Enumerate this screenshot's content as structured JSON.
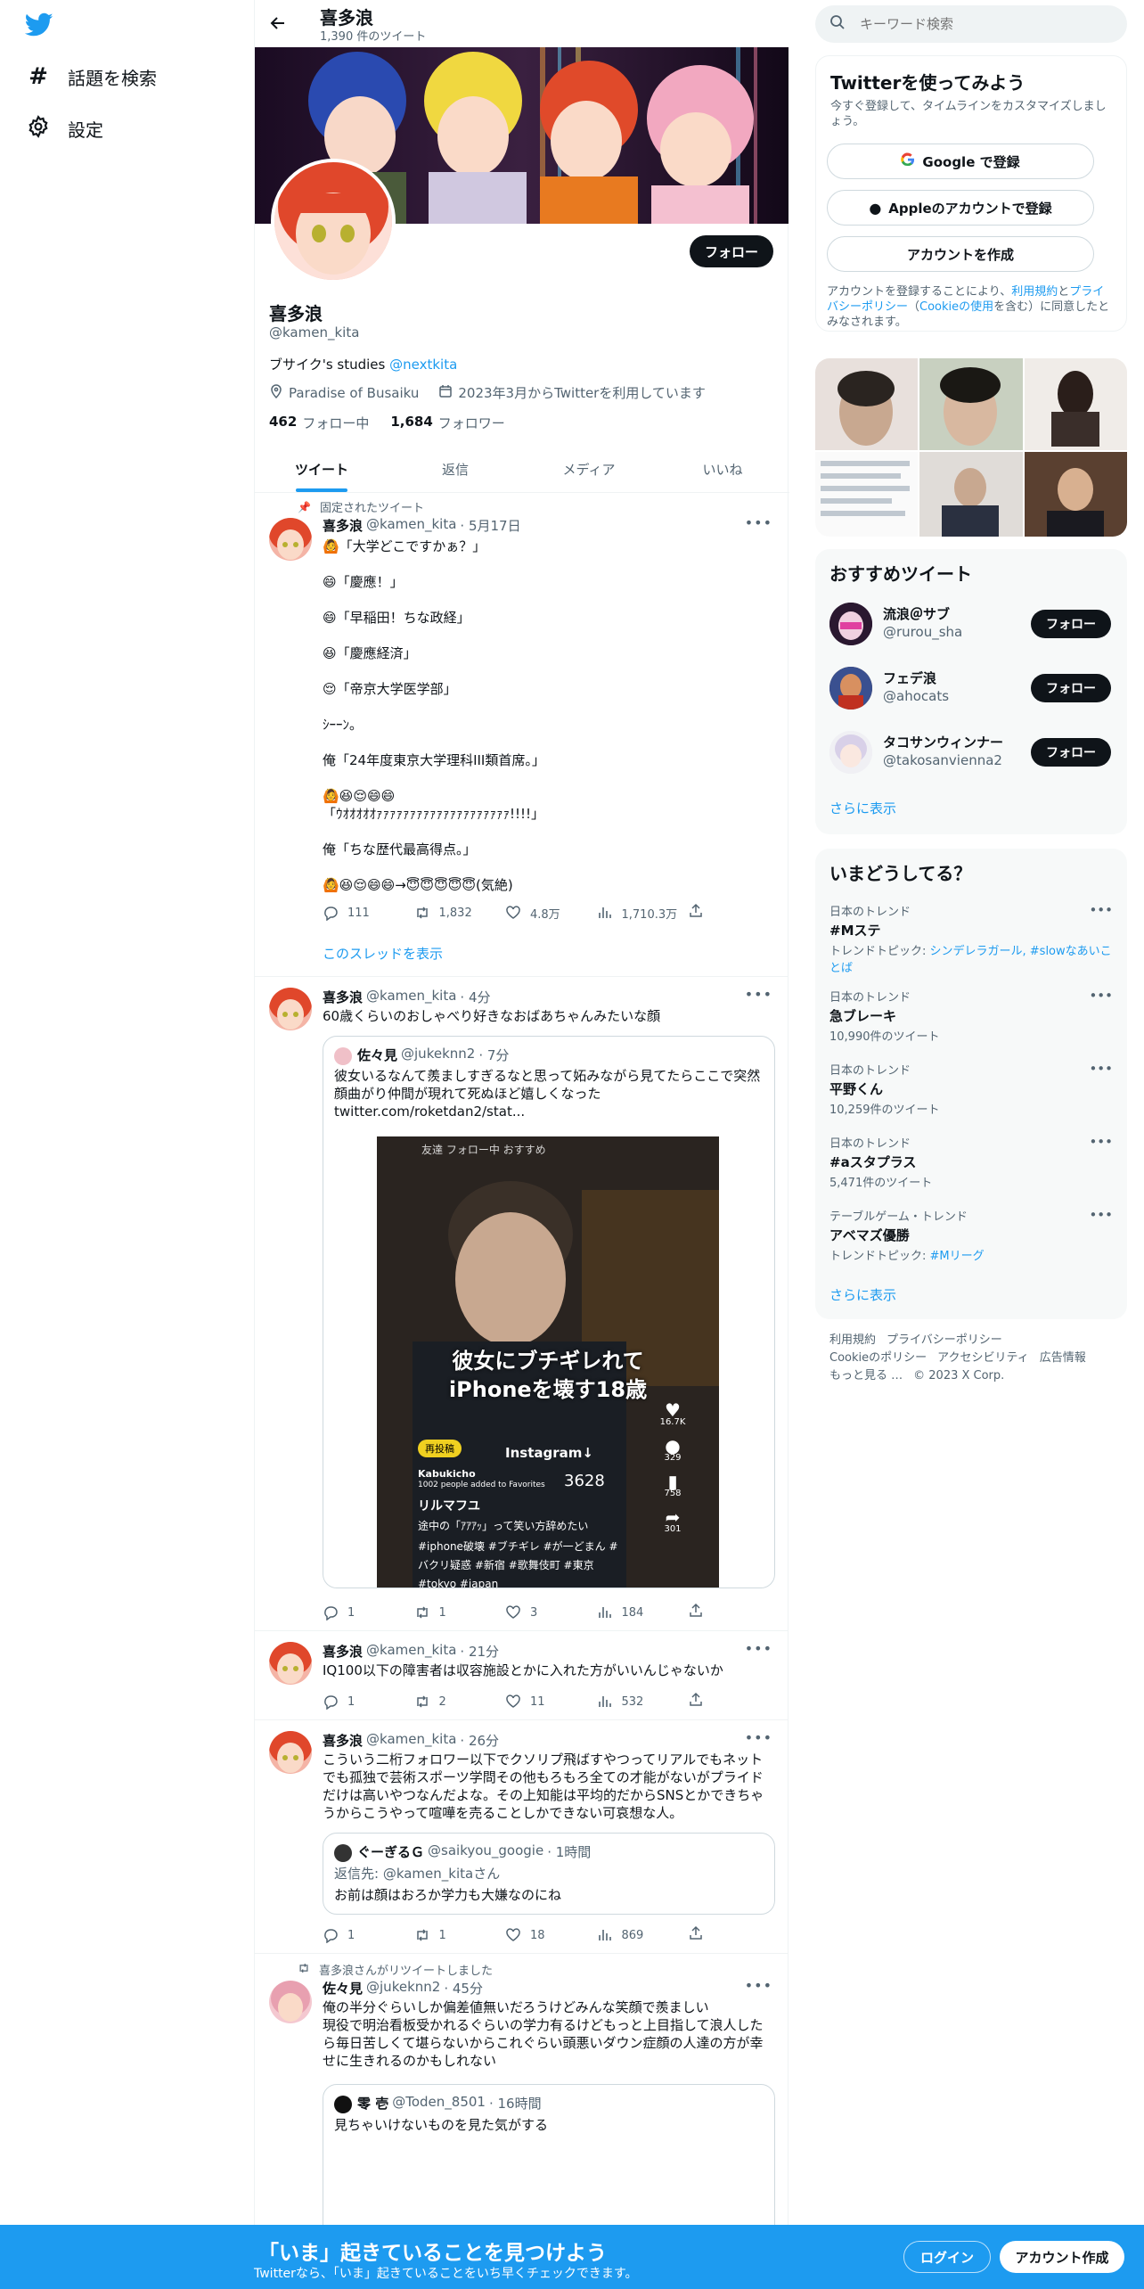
{
  "leftnav": {
    "items": [
      {
        "label": "話題を検索",
        "icon": "hashtag-icon"
      },
      {
        "label": "設定",
        "icon": "gear-icon"
      }
    ]
  },
  "header": {
    "name": "喜多浪",
    "tweet_count": "1,390 件のツイート"
  },
  "profile": {
    "name": "喜多浪",
    "handle": "@kamen_kita",
    "follow_label": "フォロー",
    "bio_text": "ブサイク's studies ",
    "bio_link": "@nextkita",
    "location": "Paradise of Busaiku",
    "joined": "2023年3月からTwitterを利用しています",
    "following_count": "462",
    "following_label": "フォロー中",
    "followers_count": "1,684",
    "followers_label": "フォロワー"
  },
  "tabs": [
    "ツイート",
    "返信",
    "メディア",
    "いいね"
  ],
  "tweets": [
    {
      "pinned_label": "固定されたツイート",
      "name": "喜多浪",
      "handle": "@kamen_kita",
      "time": "· 5月17日",
      "text": "🙆「大学どこですかぁ？」\n\n😄「慶應！」\n\n😄「早稲田！ちな政経」\n\n😆「慶應経済」\n\n😌「帝京大学医学部」\n\nｼｰｰﾝ。\n\n俺「24年度東京大学理科III類首席。」\n\n🙆😆😌😄😄\n「ｳｵｵｵｵｵｧｧｧｧｧｧｧｧｧｧｧｧｧｧｧｧｧｧｧｧ!!!!」\n\n俺「ちな歴代最高得点。」\n\n🙆😆😌😄😄→😇😇😇😇😇(気絶)",
      "reply": "111",
      "retweet": "1,832",
      "like": "4.8万",
      "views": "1,710.3万",
      "show_thread": "このスレッドを表示"
    },
    {
      "name": "喜多浪",
      "handle": "@kamen_kita",
      "time": "· 4分",
      "text": "60歳くらいのおしゃべり好きなおばあちゃんみたいな顔",
      "quote": {
        "name": "佐々見",
        "handle": "@jukeknn2",
        "time": "· 7分",
        "text": "彼女いるなんて羨ましすぎるなと思って妬みながら見てたらここで突然顔曲がり仲間が現れて死ぬほど嬉しくなった\ntwitter.com/roketdan2/stat...",
        "video_caption_1": "彼女にブチギレれて",
        "video_caption_2": "iPhoneを壊す18歳",
        "video_top": "友達  フォロー中  おすすめ",
        "video_user": "リルマフユ",
        "video_desc": "途中の「ｱｱｱｯ」って笑い方辞めたい",
        "video_tags": "#iphone破壊 #ブチギレ #が一どまん #\nバクリ疑惑 #新宿 #歌舞伎町 #東京\n#tokyo #japan",
        "video_place": "Kabukicho",
        "video_place_sub": "1002 people added to Favorites",
        "video_instagram": "Instagram↓",
        "video_num": "3628",
        "video_repost": "再投稿",
        "video_likes": "16.7K",
        "video_comments": "329",
        "video_saves": "758",
        "video_shares": "301"
      },
      "reply": "1",
      "retweet": "1",
      "like": "3",
      "views": "184"
    },
    {
      "name": "喜多浪",
      "handle": "@kamen_kita",
      "time": "· 21分",
      "text": "IQ100以下の障害者は収容施設とかに入れた方がいいんじゃないか",
      "reply": "1",
      "retweet": "2",
      "like": "11",
      "views": "532"
    },
    {
      "name": "喜多浪",
      "handle": "@kamen_kita",
      "time": "· 26分",
      "text": "こういう二桁フォロワー以下でクソリプ飛ばすやつってリアルでもネットでも孤独で芸術スポーツ学問その他もろもろ全ての才能がないがプライドだけは高いやつなんだよな。その上知能は平均的だからSNSとかできちゃうからこうやって喧嘩を売ることしかできない可哀想な人。",
      "quote": {
        "name": "ぐーぎるＧ",
        "handle": "@saikyou_googie",
        "time": "· 1時間",
        "reply_to": "返信先: @kamen_kitaさん",
        "text": "お前は顔はおろか学力も大嫌なのにね"
      },
      "reply": "1",
      "retweet": "1",
      "like": "18",
      "views": "869"
    },
    {
      "retweeted_by": "喜多浪さんがリツイートしました",
      "name": "佐々見",
      "handle": "@jukeknn2",
      "time": "· 45分",
      "text": "俺の半分ぐらいしか偏差値無いだろうけどみんな笑顔で羨ましい\n現役で明治看板受かれるぐらいの学力有るけどもっと上目指して浪人したら毎日苦しくて堪らないからこれぐらい頭悪いダウン症顔の人達の方が幸せに生きれるのかもしれない",
      "quote": {
        "name": "零 壱",
        "handle": "@Toden_8501",
        "time": "· 16時間",
        "text": "見ちゃいけないものを見た気がする"
      }
    }
  ],
  "right": {
    "search_placeholder": "キーワード検索",
    "signup": {
      "title": "Twitterを使ってみよう",
      "subtitle": "今すぐ登録して、タイムラインをカスタマイズしましょう。",
      "google": "Google で登録",
      "apple": "Appleのアカウントで登録",
      "create": "アカウントを作成",
      "legal_1": "アカウントを登録することにより、",
      "legal_terms": "利用規約",
      "legal_2": "と",
      "legal_privacy": "プライバシーポリシー",
      "legal_3": "（",
      "legal_cookie": "Cookieの使用",
      "legal_4": "を含む）に同意したとみなされます。"
    },
    "recommend": {
      "title": "おすすめツイート",
      "follow_label": "フォロー",
      "more": "さらに表示",
      "users": [
        {
          "name": "流浪＠サブ",
          "handle": "@rurou_sha"
        },
        {
          "name": "フェデ浪",
          "handle": "@ahocats"
        },
        {
          "name": "タコサンウィンナー",
          "handle": "@takosanvienna2"
        }
      ]
    },
    "trends": {
      "title": "いまどうしてる？",
      "more": "さらに表示",
      "items": [
        {
          "cat": "日本のトレンド",
          "title": "#Mステ",
          "sub_prefix": "トレンドトピック: ",
          "sub_link": "シンデレラガール, #slowなあいことば",
          "sub": ""
        },
        {
          "cat": "日本のトレンド",
          "title": "急ブレーキ",
          "sub_prefix": "",
          "sub_link": "",
          "sub": "10,990件のツイート"
        },
        {
          "cat": "日本のトレンド",
          "title": "平野くん",
          "sub_prefix": "",
          "sub_link": "",
          "sub": "10,259件のツイート"
        },
        {
          "cat": "日本のトレンド",
          "title": "#aスタプラス",
          "sub_prefix": "",
          "sub_link": "",
          "sub": "5,471件のツイート"
        },
        {
          "cat": "テーブルゲーム・トレンド",
          "title": "アベマズ優勝",
          "sub_prefix": "トレンドトピック: ",
          "sub_link": "#Mリーグ",
          "sub": ""
        }
      ]
    },
    "footer": {
      "terms": "利用規約",
      "privacy": "プライバシーポリシー",
      "cookie": "Cookieのポリシー",
      "access": "アクセシビリティ",
      "ads": "広告情報",
      "more": "もっと見る …",
      "copyright": "© 2023 X Corp."
    }
  },
  "bottom": {
    "title": "「いま」起きていることを見つけよう",
    "subtitle": "Twitterなら、「いま」起きていることをいち早くチェックできます。",
    "login": "ログイン",
    "signup": "アカウント作成"
  }
}
